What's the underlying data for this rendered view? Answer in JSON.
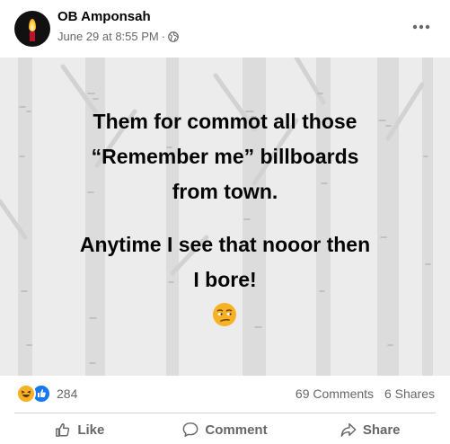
{
  "post": {
    "author": "OB Amponsah",
    "date": "June 29 at 8:55 PM",
    "separator": "·",
    "privacy_icon": "globe-icon",
    "more_icon": "more-horizontal-icon"
  },
  "content": {
    "background": "birch-forest-illustration",
    "line1": [
      "Them for commot all those",
      "“Remember me” billboards",
      "from town."
    ],
    "line2": [
      "Anytime I see that nooor then",
      "I bore!"
    ],
    "emoji": "unamused-face"
  },
  "stats": {
    "reaction_icons": [
      "haha",
      "like"
    ],
    "reaction_count": "284",
    "comments": "69 Comments",
    "shares": "6 Shares"
  },
  "actions": [
    {
      "label": "Like",
      "icon": "thumbs-up-icon"
    },
    {
      "label": "Comment",
      "icon": "comment-icon"
    },
    {
      "label": "Share",
      "icon": "share-icon"
    }
  ],
  "colors": {
    "text": "#050505",
    "secondary": "#65676b",
    "like_blue": "#1877f2",
    "haha_yellow": "#f7b125",
    "image_bg": "#ececec"
  }
}
